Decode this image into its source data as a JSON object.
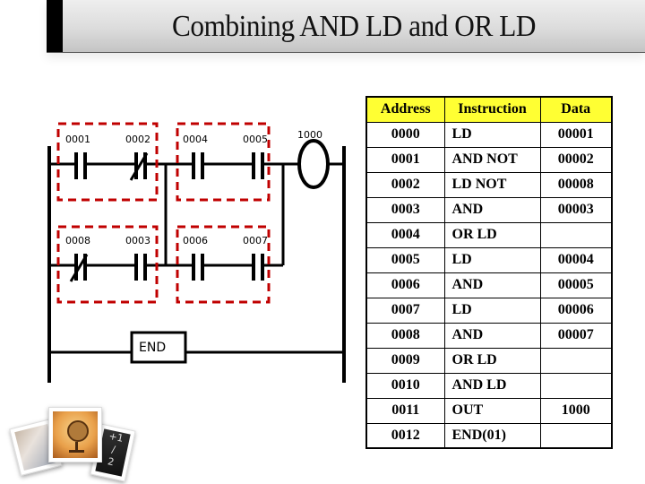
{
  "slide": {
    "title": "Combining AND LD and OR LD"
  },
  "ladder": {
    "contacts": [
      {
        "address": "0001",
        "type": "normally-open",
        "rung": 1,
        "block": "A"
      },
      {
        "address": "0002",
        "type": "normally-closed",
        "rung": 1,
        "block": "A"
      },
      {
        "address": "0004",
        "type": "normally-open",
        "rung": 1,
        "block": "B"
      },
      {
        "address": "0005",
        "type": "normally-open",
        "rung": 1,
        "block": "B"
      },
      {
        "address": "0008",
        "type": "normally-closed",
        "rung": 2,
        "block": "C"
      },
      {
        "address": "0003",
        "type": "normally-open",
        "rung": 2,
        "block": "C"
      },
      {
        "address": "0006",
        "type": "normally-open",
        "rung": 2,
        "block": "D"
      },
      {
        "address": "0007",
        "type": "normally-open",
        "rung": 2,
        "block": "D"
      }
    ],
    "output_coil": {
      "address": "1000"
    },
    "end_label": "END",
    "highlight_color": "#c00000"
  },
  "instruction_table": {
    "header_color": "#ffff33",
    "columns": [
      "Address",
      "Instruction",
      "Data"
    ],
    "rows": [
      {
        "address": "0000",
        "instruction": "LD",
        "data": "00001"
      },
      {
        "address": "0001",
        "instruction": "AND NOT",
        "data": "00002"
      },
      {
        "address": "0002",
        "instruction": "LD NOT",
        "data": "00008"
      },
      {
        "address": "0003",
        "instruction": "AND",
        "data": "00003"
      },
      {
        "address": "0004",
        "instruction": "OR LD",
        "data": ""
      },
      {
        "address": "0005",
        "instruction": "LD",
        "data": "00004"
      },
      {
        "address": "0006",
        "instruction": "AND",
        "data": "00005"
      },
      {
        "address": "0007",
        "instruction": "LD",
        "data": "00006"
      },
      {
        "address": "0008",
        "instruction": "AND",
        "data": "00007"
      },
      {
        "address": "0009",
        "instruction": "OR LD",
        "data": ""
      },
      {
        "address": "0010",
        "instruction": "AND LD",
        "data": ""
      },
      {
        "address": "0011",
        "instruction": "OUT",
        "data": "1000"
      },
      {
        "address": "0012",
        "instruction": "END(01)",
        "data": ""
      }
    ]
  },
  "decoration": {
    "photos": [
      "handwriting-photo",
      "globe-photo",
      "chalkboard-math-photo"
    ]
  }
}
